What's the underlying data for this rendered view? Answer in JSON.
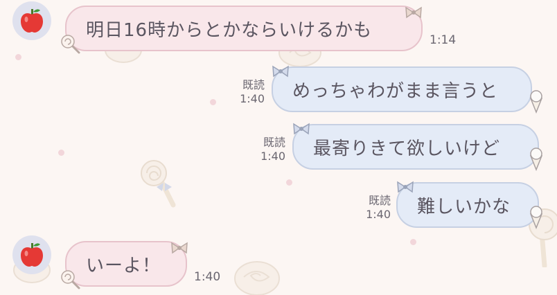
{
  "messages": [
    {
      "side": "incoming",
      "text": "明日16時からとかならいけるかも",
      "time": "1:14",
      "avatar_icon": "apple-icon"
    },
    {
      "side": "outgoing",
      "text": "めっちゃわがまま言うと",
      "read_label": "既読",
      "time": "1:40"
    },
    {
      "side": "outgoing",
      "text": "最寄りきて欲しいけど",
      "read_label": "既読",
      "time": "1:40"
    },
    {
      "side": "outgoing",
      "text": "難しいかな",
      "read_label": "既読",
      "time": "1:40"
    },
    {
      "side": "incoming",
      "text": "いーよ！",
      "time": "1:40",
      "avatar_icon": "apple-icon"
    }
  ],
  "colors": {
    "background": "#fcf6f3",
    "incoming_bubble": "#f9e7ea",
    "outgoing_bubble": "#e4ebf7",
    "avatar_bg": "#dfe1ee",
    "apple": "#e53935"
  }
}
